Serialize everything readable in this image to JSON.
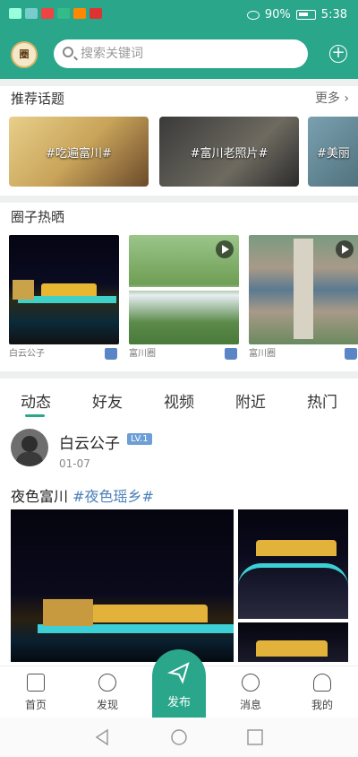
{
  "status": {
    "battery": "90%",
    "time": "5:38"
  },
  "header": {
    "logo_text": "圈",
    "search_placeholder": "搜索关键词"
  },
  "topics": {
    "title": "推荐话题",
    "more": "更多",
    "items": [
      {
        "label": "#吃遍富川#"
      },
      {
        "label": "#富川老照片#"
      },
      {
        "label": "#美丽"
      }
    ]
  },
  "hot": {
    "title": "圈子热晒",
    "cards": [
      {
        "author": "白云公子",
        "video": false
      },
      {
        "author": "富川圈",
        "video": true
      },
      {
        "author": "富川圈",
        "video": true
      }
    ]
  },
  "tabs": [
    {
      "label": "动态"
    },
    {
      "label": "好友"
    },
    {
      "label": "视频"
    },
    {
      "label": "附近"
    },
    {
      "label": "热门"
    }
  ],
  "post": {
    "username": "白云公子",
    "level": "LV.1",
    "date": "01-07",
    "text": "夜色富川",
    "tag": "#夜色瑶乡#"
  },
  "nav": [
    {
      "label": "首页"
    },
    {
      "label": "发现"
    },
    {
      "label": "发布"
    },
    {
      "label": "消息"
    },
    {
      "label": "我的"
    }
  ],
  "colors": {
    "brand": "#2aa68b",
    "tag": "#4a7fb8",
    "level_badge": "#6d9fd6"
  }
}
